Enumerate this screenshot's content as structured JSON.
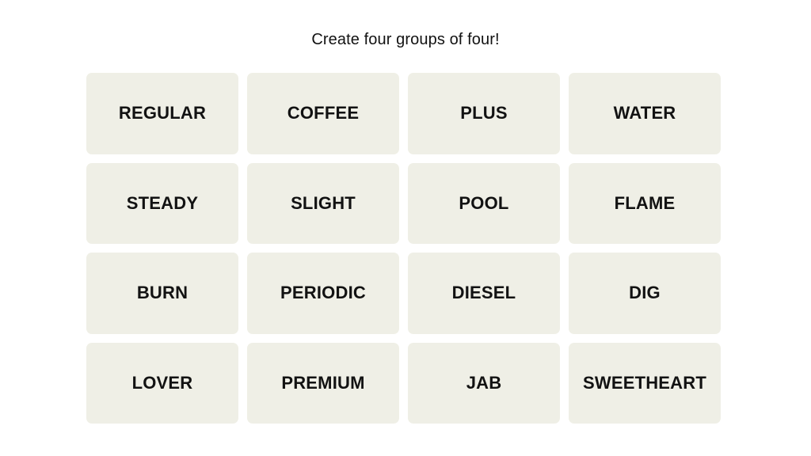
{
  "page": {
    "background_color": "#ffffff",
    "title": "Create four groups of four!"
  },
  "board": {
    "tile_color": "#efefe6",
    "text_color": "#121212",
    "rows": 4,
    "columns": 4,
    "tiles": [
      {
        "label": "REGULAR"
      },
      {
        "label": "COFFEE"
      },
      {
        "label": "PLUS"
      },
      {
        "label": "WATER"
      },
      {
        "label": "STEADY"
      },
      {
        "label": "SLIGHT"
      },
      {
        "label": "POOL"
      },
      {
        "label": "FLAME"
      },
      {
        "label": "BURN"
      },
      {
        "label": "PERIODIC"
      },
      {
        "label": "DIESEL"
      },
      {
        "label": "DIG"
      },
      {
        "label": "LOVER"
      },
      {
        "label": "PREMIUM"
      },
      {
        "label": "JAB"
      },
      {
        "label": "SWEETHEART"
      }
    ]
  }
}
